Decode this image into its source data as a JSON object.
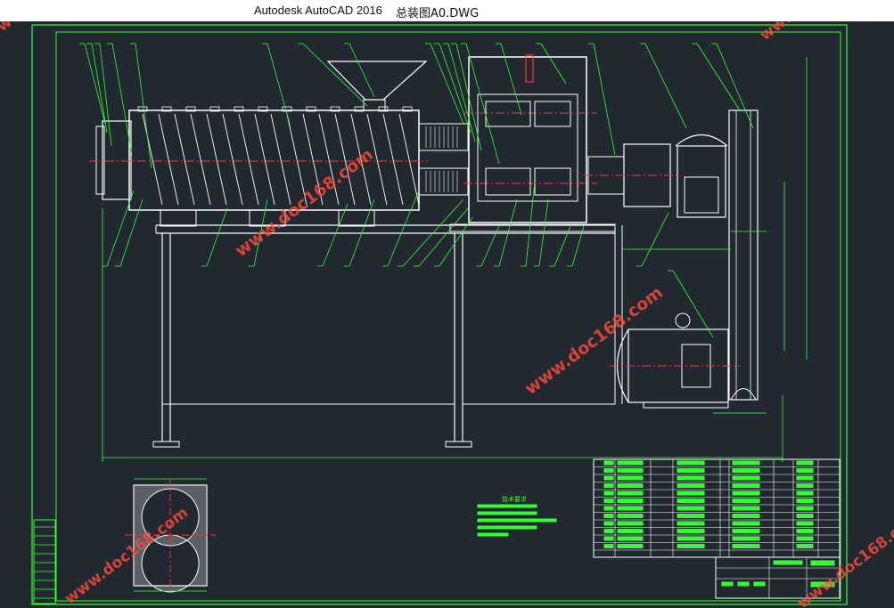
{
  "window": {
    "app_title": "Autodesk AutoCAD 2016",
    "file_name": "总装图A0.DWG"
  },
  "drawing": {
    "watermark": "www.doc168.com",
    "notes_title": "技术要求"
  },
  "colors": {
    "background": "#212830",
    "frame": "#33ff33",
    "geometry": "#ffffff",
    "dimension": "#33ff33",
    "centerline": "#ff3333",
    "hatch": "#ff3333",
    "watermark": "#ff4a3a"
  }
}
